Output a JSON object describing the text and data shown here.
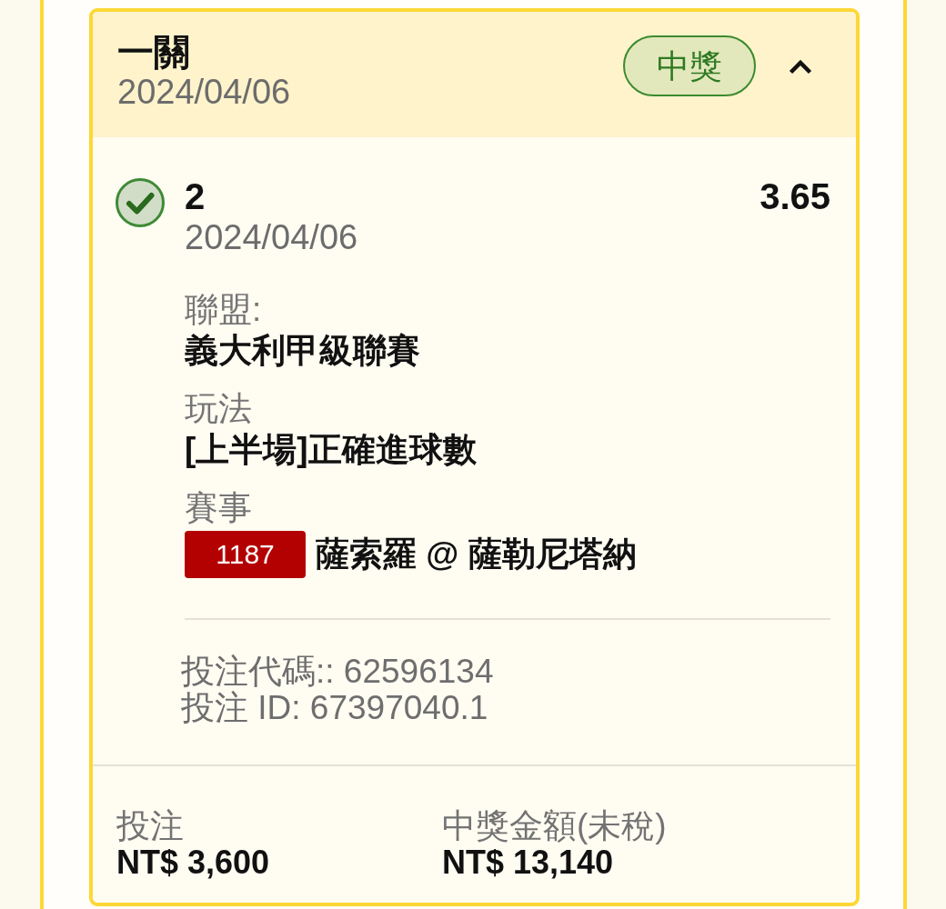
{
  "bet_card": {
    "title": "一關",
    "date": "2024/04/06",
    "status": {
      "label": "中獎",
      "kind": "won"
    },
    "expanded": true,
    "selections": [
      {
        "won": true,
        "pick": "2",
        "odds": "3.65",
        "date": "2024/04/06",
        "details": [
          {
            "label": "聯盟:",
            "value": "義大利甲級聯賽"
          },
          {
            "label": "玩法",
            "value": "[上半場]正確進球數"
          },
          {
            "label": "賽事",
            "match_number": "1187",
            "value": "薩索羅 @ 薩勒尼塔納"
          }
        ],
        "bet_code": "投注代碼:: 62596134",
        "bet_id": "投注 ID: 67397040.1"
      }
    ],
    "summary": [
      {
        "label": "投注",
        "value": "NT$ 3,600"
      },
      {
        "label": "中獎金額(未稅)",
        "value": "NT$ 13,140"
      }
    ]
  }
}
